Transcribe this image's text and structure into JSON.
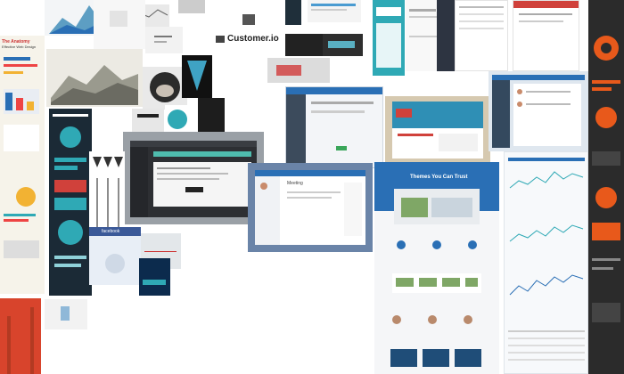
{
  "collage": {
    "brand_name": "Customer.io",
    "infographic_title_line1": "The Anatomy",
    "infographic_title_line2": "Effective Web Design",
    "app_header_title": "Meeting",
    "theme_headline": "Themes You Can Trust",
    "facebook_label": "facebook"
  },
  "icons": [
    "customerio-logo-icon",
    "dog-photo",
    "arrow-icon"
  ],
  "colors": {
    "accent_blue": "#2a6fb5",
    "accent_orange": "#e8591b",
    "accent_red": "#d0413b",
    "dark_panel": "#2d2f33",
    "teal": "#2fa9b5"
  }
}
